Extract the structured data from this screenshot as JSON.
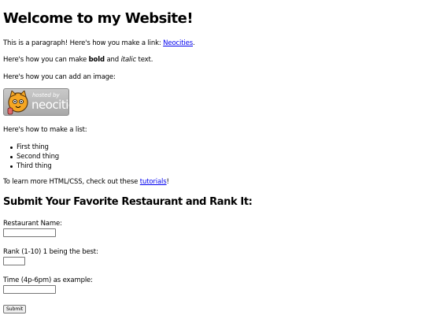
{
  "heading": "Welcome to my Website!",
  "para1": {
    "before": "This is a paragraph! Here's how you make a link: ",
    "link": "Neocities",
    "after": "."
  },
  "para2": {
    "before": "Here's how you can make ",
    "bold": "bold",
    "mid": " and ",
    "italic": "italic",
    "after": " text."
  },
  "para3": "Here's how you can add an image:",
  "badge": {
    "hosted_by": "hosted by",
    "brand": "neocities",
    "icon": "neocities-cat-icon"
  },
  "para4": "Here's how to make a list:",
  "list": [
    "First thing",
    "Second thing",
    "Third thing"
  ],
  "para5": {
    "before": "To learn more HTML/CSS, check out these ",
    "link": "tutorials",
    "after": "!"
  },
  "form": {
    "heading": "Submit Your Favorite Restaurant and Rank It:",
    "name_label": "Restaurant Name:",
    "name_value": "",
    "rank_label": "Rank (1-10) 1 being the best:",
    "rank_value": "",
    "time_label": "Time (4p-6pm) as example:",
    "time_value": "",
    "submit_label": "Submit"
  },
  "colors": {
    "link": "#0000ee",
    "text": "#000000",
    "badge_bg": "#b9b9b9"
  }
}
